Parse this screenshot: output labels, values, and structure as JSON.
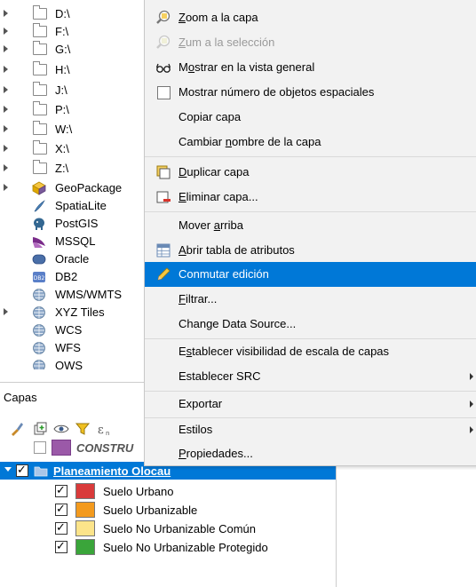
{
  "browser": {
    "drives": [
      {
        "label": "D:\\"
      },
      {
        "label": "F:\\"
      },
      {
        "label": "G:\\"
      },
      {
        "label": "H:\\"
      },
      {
        "label": "J:\\"
      },
      {
        "label": "P:\\"
      },
      {
        "label": "W:\\"
      },
      {
        "label": "X:\\"
      },
      {
        "label": "Z:\\"
      }
    ],
    "providers": [
      {
        "label": "GeoPackage",
        "icon": "geopackage-icon",
        "expandable": true
      },
      {
        "label": "SpatiaLite",
        "icon": "spatialite-icon",
        "expandable": false
      },
      {
        "label": "PostGIS",
        "icon": "postgis-icon",
        "expandable": false
      },
      {
        "label": "MSSQL",
        "icon": "mssql-icon",
        "expandable": false
      },
      {
        "label": "Oracle",
        "icon": "oracle-icon",
        "expandable": false
      },
      {
        "label": "DB2",
        "icon": "db2-icon",
        "expandable": false
      },
      {
        "label": "WMS/WMTS",
        "icon": "globe-icon",
        "expandable": false
      },
      {
        "label": "XYZ Tiles",
        "icon": "globe-icon",
        "expandable": true
      },
      {
        "label": "WCS",
        "icon": "globe-icon",
        "expandable": false
      },
      {
        "label": "WFS",
        "icon": "globe-icon",
        "expandable": false
      },
      {
        "label": "OWS",
        "icon": "globe-icon",
        "expandable": false
      }
    ]
  },
  "layers": {
    "title": "Capas",
    "construct_layer": "CONSTRU",
    "group": "Planeamiento Olocau",
    "items": [
      {
        "label": "Suelo Urbano",
        "color": "#d93a3a"
      },
      {
        "label": "Suelo Urbanizable",
        "color": "#f39a1e"
      },
      {
        "label": "Suelo No Urbanizable Común",
        "color": "#fce48a"
      },
      {
        "label": "Suelo No Urbanizable Protegido",
        "color": "#3aa53a"
      }
    ]
  },
  "colors": {
    "selection": "#0078d7",
    "menu_bg": "#f2f2f2",
    "construct_swatch": "#9b59a8"
  },
  "menu": {
    "items": [
      {
        "pre": "",
        "u": "Z",
        "post": "oom a la capa",
        "icon": "zoom-layer-icon",
        "disabled": false
      },
      {
        "pre": "",
        "u": "Z",
        "post": "um a la selección",
        "icon": "zoom-selection-icon",
        "disabled": true
      },
      {
        "pre": "M",
        "u": "o",
        "post": "strar en la vista general",
        "icon": "overview-icon",
        "disabled": false
      },
      {
        "pre": "Mostrar número de objetos espaciales",
        "u": "",
        "post": "",
        "icon": "checkbox",
        "disabled": false
      },
      {
        "pre": "Copiar capa",
        "u": "",
        "post": "",
        "icon": "",
        "disabled": false
      },
      {
        "pre": "Cambiar ",
        "u": "n",
        "post": "ombre de la capa",
        "icon": "",
        "disabled": false
      },
      {
        "pre": "",
        "u": "D",
        "post": "uplicar capa",
        "icon": "duplicate-layer-icon",
        "disabled": false
      },
      {
        "pre": "",
        "u": "E",
        "post": "liminar capa...",
        "icon": "remove-layer-icon",
        "disabled": false
      },
      {
        "pre": "Mover ",
        "u": "a",
        "post": "rriba",
        "icon": "",
        "disabled": false
      },
      {
        "pre": "",
        "u": "A",
        "post": "brir tabla de atributos",
        "icon": "attribute-table-icon",
        "disabled": false
      },
      {
        "pre": "Conmutar edición",
        "u": "",
        "post": "",
        "icon": "pencil-icon",
        "disabled": false,
        "selected": true
      },
      {
        "pre": "",
        "u": "F",
        "post": "iltrar...",
        "icon": "",
        "disabled": false
      },
      {
        "pre": "Change Data Source...",
        "u": "",
        "post": "",
        "icon": "",
        "disabled": false
      },
      {
        "pre": "E",
        "u": "s",
        "post": "tablecer visibilidad de escala de capas",
        "icon": "",
        "disabled": false
      },
      {
        "pre": "Establecer SRC",
        "u": "",
        "post": "",
        "icon": "",
        "disabled": false,
        "submenu": true
      },
      {
        "pre": "Exportar",
        "u": "",
        "post": "",
        "icon": "",
        "disabled": false,
        "submenu": true
      },
      {
        "pre": "Estilos",
        "u": "",
        "post": "",
        "icon": "",
        "disabled": false,
        "submenu": true
      },
      {
        "pre": "",
        "u": "P",
        "post": "ropiedades...",
        "icon": "",
        "disabled": false
      }
    ]
  }
}
